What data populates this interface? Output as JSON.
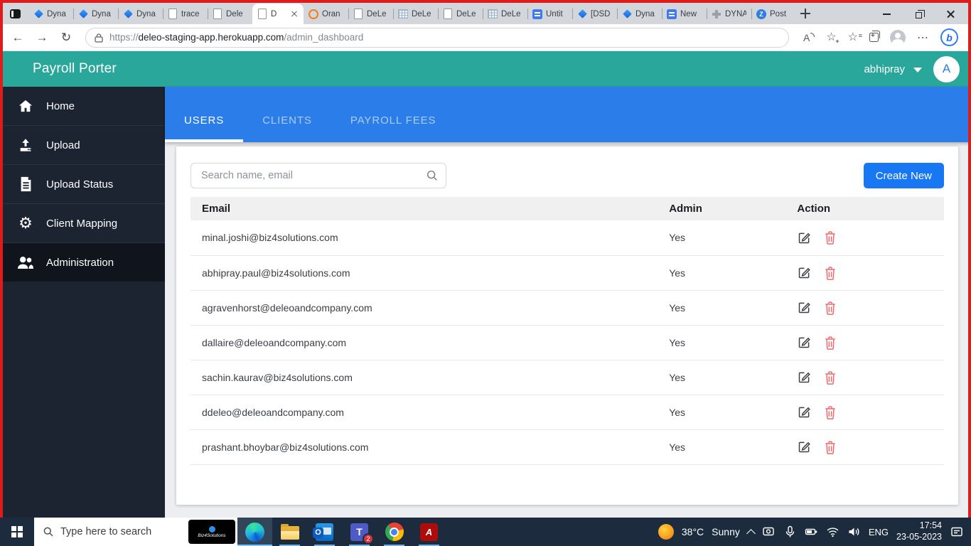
{
  "browser": {
    "tabs": [
      {
        "label": "Dyna",
        "icon": "dynamics"
      },
      {
        "label": "Dyna",
        "icon": "dynamics"
      },
      {
        "label": "Dyna",
        "icon": "dynamics"
      },
      {
        "label": "trace",
        "icon": "page"
      },
      {
        "label": "Dele",
        "icon": "page"
      },
      {
        "label": "D",
        "icon": "page",
        "active": true
      },
      {
        "label": "Oran",
        "icon": "orange"
      },
      {
        "label": "DeLe",
        "icon": "page"
      },
      {
        "label": "DeLe",
        "icon": "sheet"
      },
      {
        "label": "DeLe",
        "icon": "page"
      },
      {
        "label": "DeLe",
        "icon": "sheet"
      },
      {
        "label": "Untit",
        "icon": "bluelist"
      },
      {
        "label": "[DSD",
        "icon": "dynamics"
      },
      {
        "label": "Dyna",
        "icon": "dynamics"
      },
      {
        "label": "New",
        "icon": "bluelist"
      },
      {
        "label": "DYNA",
        "icon": "plus"
      },
      {
        "label": "Post",
        "icon": "z"
      }
    ],
    "url": {
      "scheme": "https://",
      "domain": "deleo-staging-app.herokuapp.com",
      "path": "/admin_dashboard"
    }
  },
  "header": {
    "title": "Payroll Porter",
    "user": "abhipray",
    "avatar_initial": "A"
  },
  "sidebar": {
    "items": [
      {
        "label": "Home",
        "icon": "home"
      },
      {
        "label": "Upload",
        "icon": "upload"
      },
      {
        "label": "Upload Status",
        "icon": "document"
      },
      {
        "label": "Client Mapping",
        "icon": "gear"
      },
      {
        "label": "Administration",
        "icon": "people",
        "active": true
      }
    ]
  },
  "main": {
    "tabs": [
      {
        "label": "USERS",
        "active": true
      },
      {
        "label": "CLIENTS",
        "active": false
      },
      {
        "label": "PAYROLL FEES",
        "active": false
      }
    ],
    "search_placeholder": "Search name, email",
    "create_button": "Create New",
    "table": {
      "headers": [
        "Email",
        "Admin",
        "Action"
      ],
      "rows": [
        {
          "email": "minal.joshi@biz4solutions.com",
          "admin": "Yes"
        },
        {
          "email": "abhipray.paul@biz4solutions.com",
          "admin": "Yes"
        },
        {
          "email": "agravenhorst@deleoandcompany.com",
          "admin": "Yes"
        },
        {
          "email": "dallaire@deleoandcompany.com",
          "admin": "Yes"
        },
        {
          "email": "sachin.kaurav@biz4solutions.com",
          "admin": "Yes"
        },
        {
          "email": "ddeleo@deleoandcompany.com",
          "admin": "Yes"
        },
        {
          "email": "prashant.bhoybar@biz4solutions.com",
          "admin": "Yes"
        }
      ]
    }
  },
  "taskbar": {
    "search_placeholder": "Type here to search",
    "search_logo": "Biz4Solutions",
    "teams_badge": "2",
    "weather_temp": "38°C",
    "weather_condition": "Sunny",
    "language": "ENG",
    "time": "17:54",
    "date": "23-05-2023"
  },
  "colors": {
    "header_teal": "#2aa79b",
    "tab_bar_blue": "#2b7de9",
    "button_blue": "#1877f2",
    "delete_red": "#f1696e",
    "sidebar_dark": "#1c2432",
    "taskbar_dark": "#1c2b3d",
    "screen_border_red": "#df1c1c"
  }
}
